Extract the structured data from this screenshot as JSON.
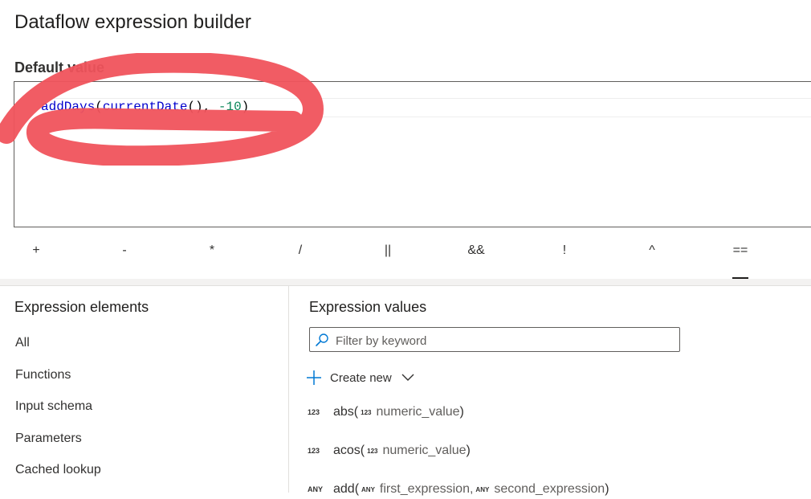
{
  "header": {
    "title": "Dataflow expression builder"
  },
  "default_value": {
    "label": "Default value",
    "code": {
      "fn1": "addDays",
      "p1": "(",
      "fn2": "currentDate",
      "p2": "(), ",
      "num": "-10",
      "p3": ")"
    }
  },
  "annotation": {
    "color": "#f0535c"
  },
  "operators": [
    "+",
    "-",
    "*",
    "/",
    "||",
    "&&",
    "!",
    "^",
    "=="
  ],
  "expression_elements": {
    "title": "Expression elements",
    "items": [
      "All",
      "Functions",
      "Input schema",
      "Parameters",
      "Cached lookup"
    ]
  },
  "expression_values": {
    "title": "Expression values",
    "filter_placeholder": "Filter by keyword",
    "create_new_label": "Create new",
    "items": [
      {
        "type": "123",
        "name": "abs(",
        "params": [
          {
            "type": "123",
            "name": "numeric_value"
          }
        ],
        "close": ")"
      },
      {
        "type": "123",
        "name": "acos(",
        "params": [
          {
            "type": "123",
            "name": "numeric_value"
          }
        ],
        "close": ")"
      },
      {
        "type": "ANY",
        "name": "add(",
        "params": [
          {
            "type": "ANY",
            "name": "first_expression, "
          },
          {
            "type": "ANY",
            "name": "second_expression"
          }
        ],
        "close": ")"
      }
    ]
  }
}
